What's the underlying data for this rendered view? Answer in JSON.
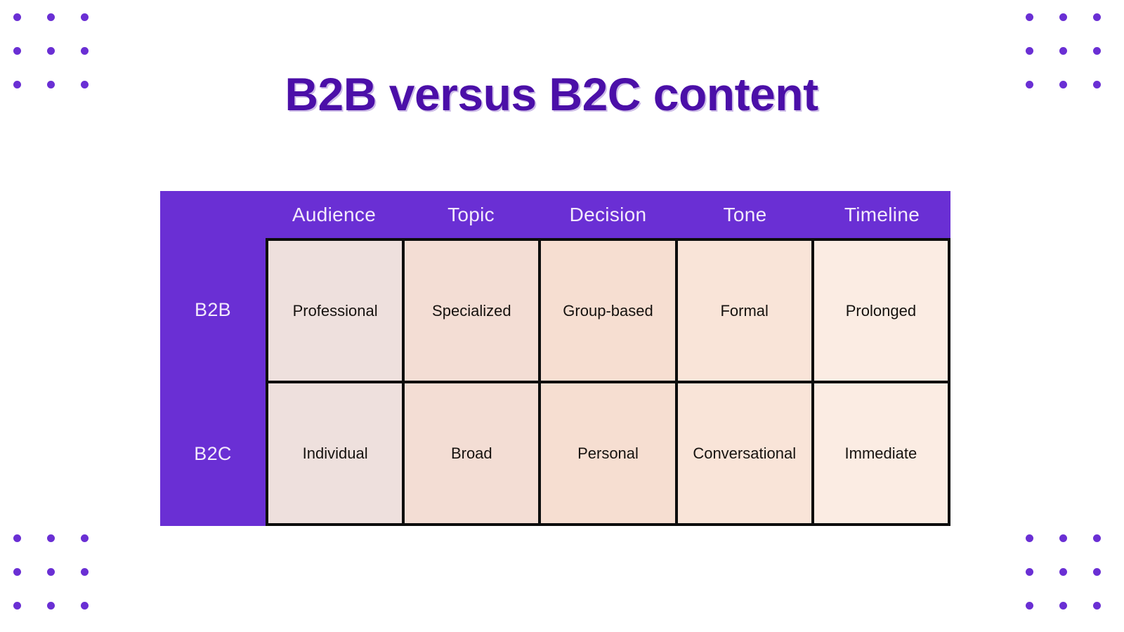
{
  "title": "B2B versus B2C content",
  "colors": {
    "title_text": "#4B0FA8",
    "table_accent": "#6A2FD4",
    "header_text": "#F2E9FB",
    "cell_border": "#0D0D0D",
    "cell_text": "#16120F",
    "dot": "#6A2FD4",
    "background_left": "#E9E3F8",
    "background_center": "#F6DDD2",
    "background_right": "#FEFBF8"
  },
  "table": {
    "corner_label": "",
    "column_headers": [
      "Audience",
      "Topic",
      "Decision",
      "Tone",
      "Timeline"
    ],
    "rows": [
      {
        "label": "B2B",
        "cells": [
          "Professional",
          "Specialized",
          "Group-based",
          "Formal",
          "Prolonged"
        ]
      },
      {
        "label": "B2C",
        "cells": [
          "Individual",
          "Broad",
          "Personal",
          "Conversational",
          "Immediate"
        ]
      }
    ]
  },
  "decor": {
    "dot_grid_rows": 3,
    "dot_grid_cols": 3,
    "corners": [
      "top-left",
      "top-right",
      "bottom-left",
      "bottom-right"
    ]
  }
}
